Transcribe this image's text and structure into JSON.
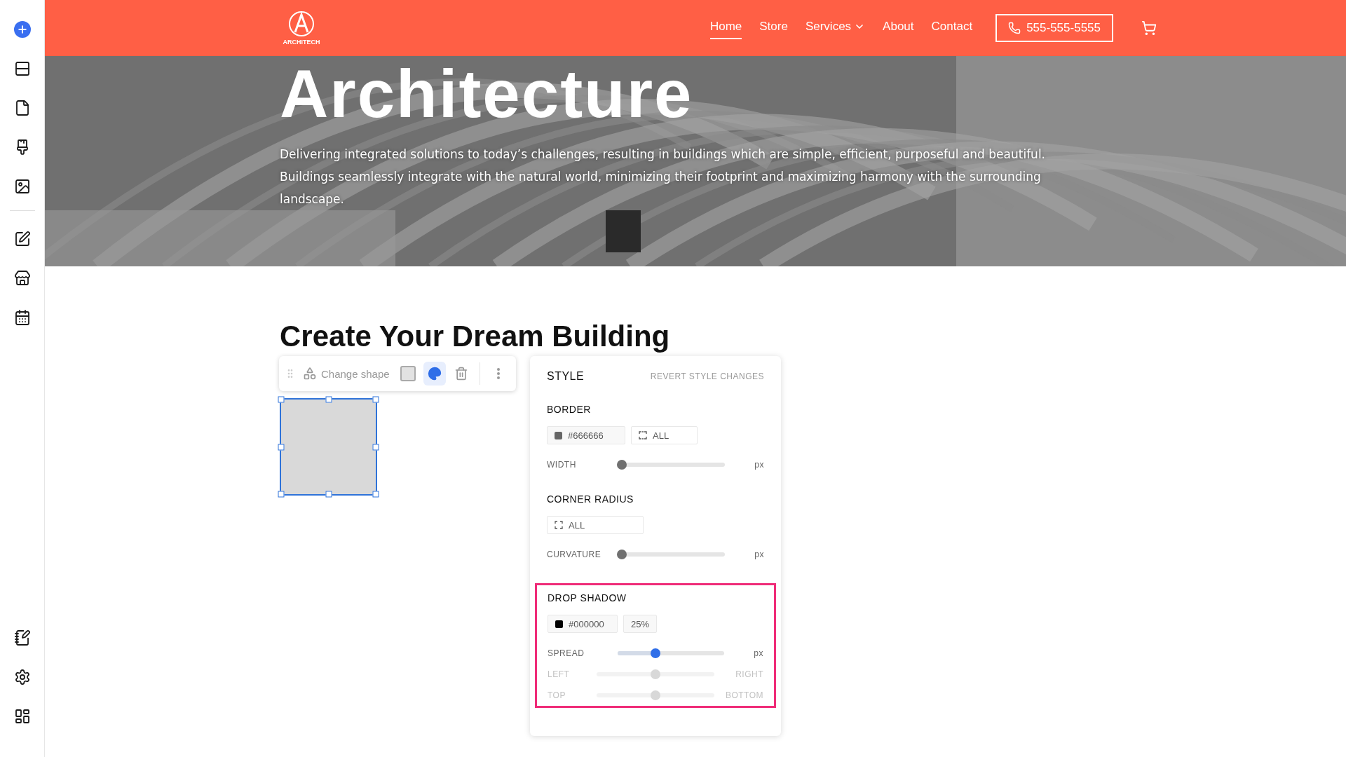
{
  "header": {
    "logo": "ARCHITECH",
    "nav": [
      {
        "label": "Home",
        "selected": true,
        "dropdown": false
      },
      {
        "label": "Store",
        "selected": false,
        "dropdown": false
      },
      {
        "label": "Services",
        "selected": false,
        "dropdown": true
      },
      {
        "label": "About",
        "selected": false,
        "dropdown": false
      },
      {
        "label": "Contact",
        "selected": false,
        "dropdown": false
      }
    ],
    "phone": "555-555-5555"
  },
  "hero": {
    "title": "Architecture",
    "text": "Delivering integrated solutions to today’s challenges, resulting in buildings which are simple, efficient, purposeful and beautiful. Buildings seamlessly integrate with the natural world, minimizing their footprint and maximizing harmony with the surrounding landscape."
  },
  "section": {
    "heading": "Create Your Dream Building"
  },
  "toolbar": {
    "change_shape": "Change shape",
    "tools": [
      {
        "kind": "fill",
        "selected": false
      },
      {
        "kind": "style",
        "selected": true
      },
      {
        "kind": "delete",
        "selected": false
      }
    ]
  },
  "style_panel": {
    "title": "STYLE",
    "revert": "REVERT STYLE CHANGES",
    "border": {
      "heading": "BORDER",
      "color": "#666666",
      "color_text": "#666666",
      "sides": "ALL",
      "slider": {
        "label": "WIDTH",
        "level": 0,
        "unit": "px"
      }
    },
    "corner": {
      "heading": "CORNER RADIUS",
      "sides": "ALL",
      "slider": {
        "label": "CURVATURE",
        "level": 0,
        "unit": "px"
      }
    },
    "shadow": {
      "heading": "DROP SHADOW",
      "highlighted": true,
      "color": "#000000",
      "color_text": "#000000",
      "opacity": "25%",
      "slider": {
        "label": "SPREAD",
        "level": 0.34,
        "unit": "px"
      },
      "offsets": [
        {
          "start": "LEFT",
          "end": "RIGHT",
          "level": 0.5,
          "disabled": true
        },
        {
          "start": "TOP",
          "end": "BOTTOM",
          "level": 0.5,
          "disabled": true
        }
      ]
    }
  }
}
